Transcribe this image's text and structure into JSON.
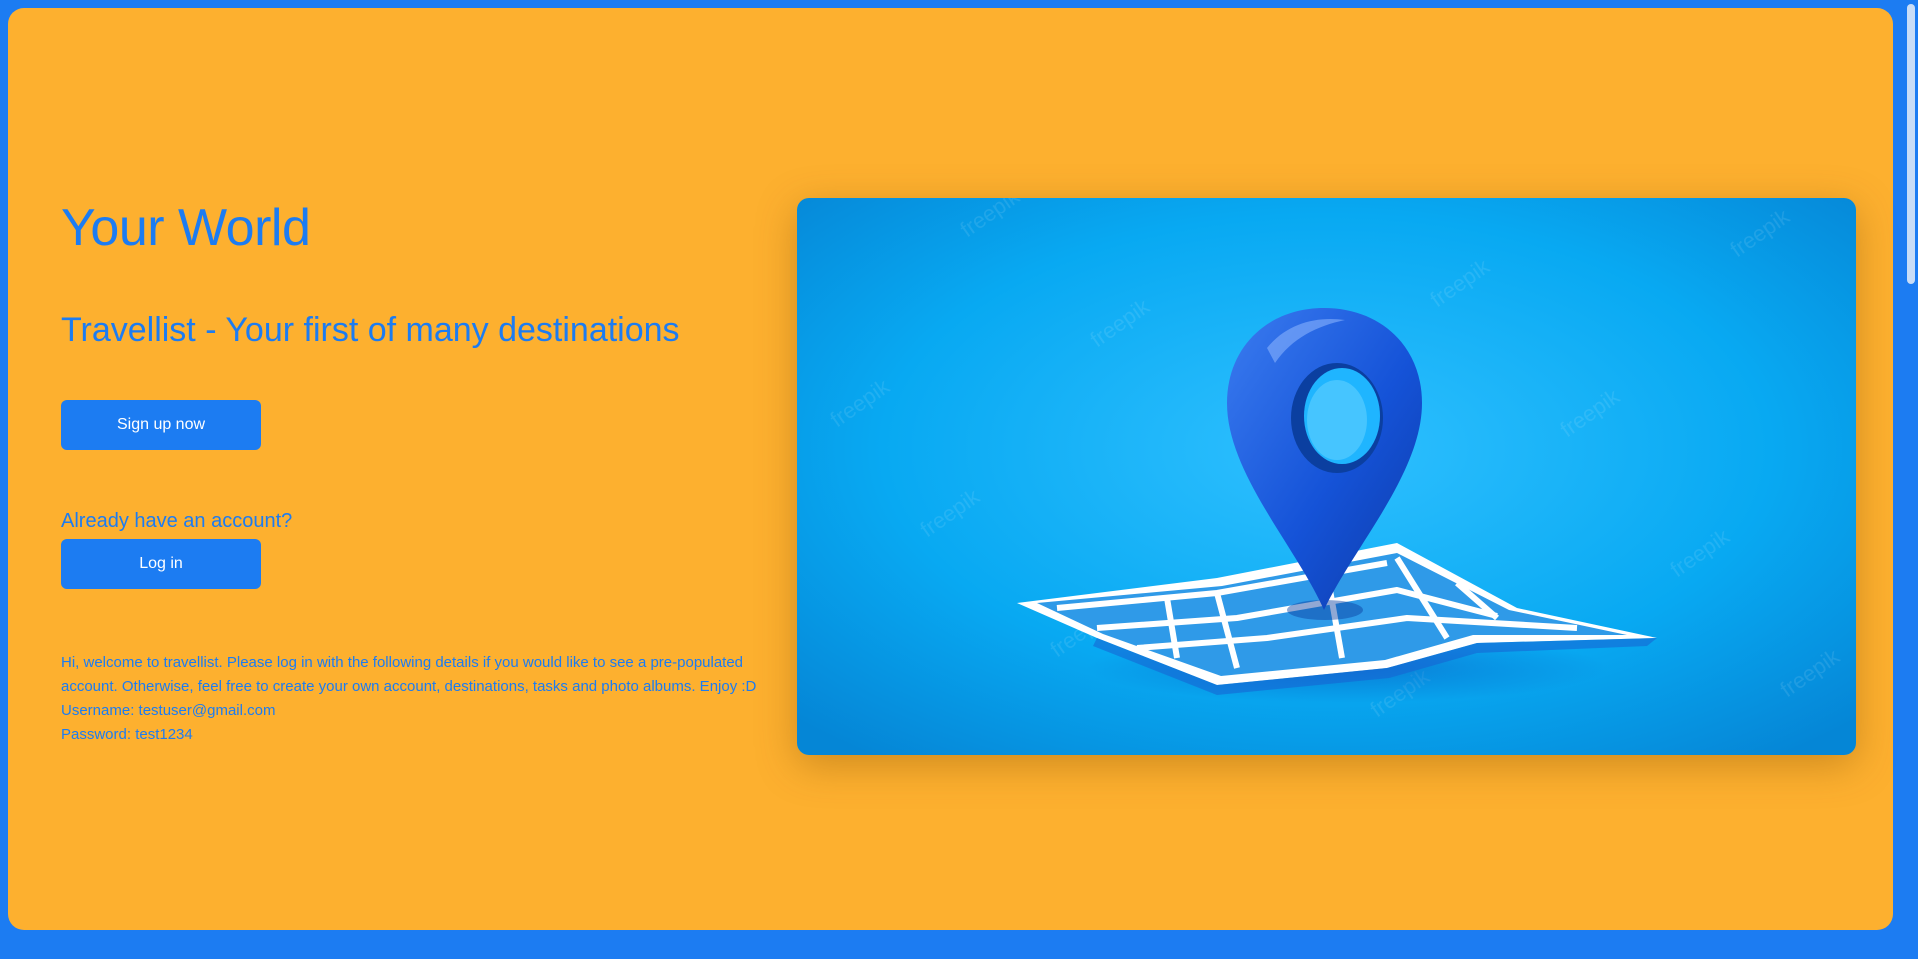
{
  "hero": {
    "title": "Your World",
    "subtitle": "Travellist - Your first of many destinations"
  },
  "actions": {
    "signup_label": "Sign up now",
    "account_prompt": "Already have an account?",
    "login_label": "Log in"
  },
  "info": {
    "welcome": "Hi, welcome to travellist. Please log in with the following details if you would like to see a pre-populated account. Otherwise, feel free to create your own account, destinations, tasks and photo albums. Enjoy :D",
    "username": "Username: testuser@gmail.com",
    "password": "Password: test1234"
  },
  "image": {
    "icon": "location-pin-on-map",
    "watermark": "freepik"
  },
  "colors": {
    "page_background": "#1c7cf2",
    "card_background": "#fdb02f",
    "accent": "#1c7cf2",
    "button_text": "#ffffff"
  }
}
